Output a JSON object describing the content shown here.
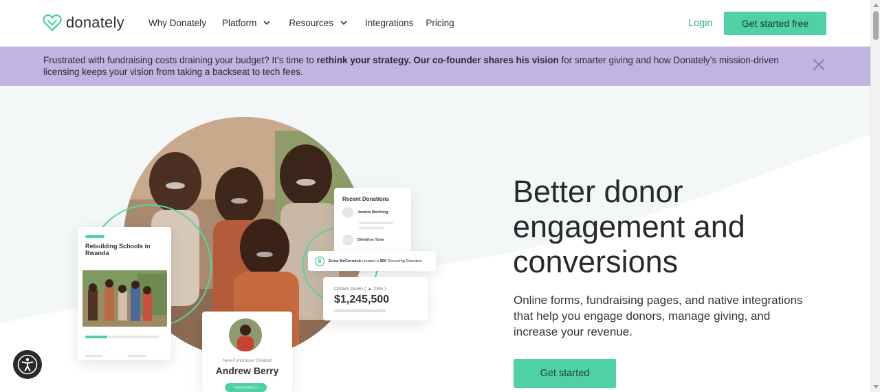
{
  "header": {
    "logo_text": "donately",
    "nav": [
      {
        "label": "Why Donately",
        "has_dropdown": false
      },
      {
        "label": "Platform",
        "has_dropdown": true
      },
      {
        "label": "Resources",
        "has_dropdown": true
      },
      {
        "label": "Integrations",
        "has_dropdown": false
      },
      {
        "label": "Pricing",
        "has_dropdown": false
      }
    ],
    "login_label": "Login",
    "cta_label": "Get started free"
  },
  "banner": {
    "text_before": "Frustrated with fundraising costs draining your budget? It’s time to ",
    "text_bold": "rethink your strategy. Our co-founder shares his vision",
    "text_after": " for smarter giving and how Donately’s mission-driven licensing keeps your vision from taking a backseat to tech fees."
  },
  "hero": {
    "headline": "Better donor engagement and conversions",
    "subtext": "Online forms, fundraising pages, and native integrations that help you engage donors, manage giving, and increase your revenue.",
    "cta_label": "Get started"
  },
  "cards": {
    "school_title": "Rebuilding Schools in Rwanda",
    "school_progress_fraction": 0.3,
    "recent_title": "Recent Donations",
    "recent_donors": [
      {
        "prefix": "Jan",
        "name": "Janette Mechling"
      },
      {
        "prefix": "Jan",
        "name": "Dimitrios Tuna"
      }
    ],
    "erica_name": "Erica McCormick",
    "erica_action": "created a",
    "erica_amount": "$50",
    "erica_type": "Recurring Donation",
    "given_label": "Dollars Given ( ▲ 23% )",
    "given_amount": "$1,245,500",
    "fund_label": "New Fundraiser Created",
    "fund_name": "Andrew Berry",
    "fund_button": "VIEW PROFILE »"
  },
  "colors": {
    "brand": "#4fd1a5",
    "banner": "#c1b4e2",
    "login": "#2cb689"
  }
}
